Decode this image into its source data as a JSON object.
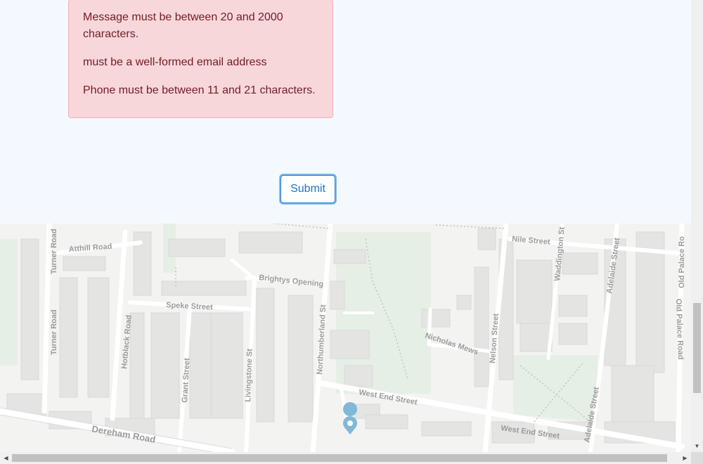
{
  "form": {
    "errors": [
      "Message must be between 20 and 2000 characters.",
      "must be a well-formed email address",
      "Phone must be between 11 and 21 characters."
    ],
    "submit_label": "Submit"
  },
  "map": {
    "streets": {
      "atthill": "Atthill Road",
      "turner_top": "Turner Road",
      "turner": "Turner Road",
      "brightys": "Brightys Opening",
      "speke": "Speke Street",
      "hotblack": "Hotblack Road",
      "grant": "Grant Street",
      "livingstone": "Livingstone St",
      "northumberland": "Northumberland St",
      "nicholas": "Nicholas Mews",
      "nelson": "Nelson Street",
      "nile": "Nile Street",
      "waddington": "Waddington St",
      "adelaide_top": "Adelaide Street",
      "adelaide_bottom": "Adelaide Street",
      "old_palace_1": "Old Palace Ro",
      "old_palace_2": "Old Palace Road",
      "west_end_1": "West End Street",
      "west_end_2": "West End Street",
      "dereham": "Dereham Road"
    },
    "colors": {
      "background": "#f3f3f1",
      "buildings": "#e4e4e2",
      "roads": "#ffffff",
      "green": "#e6efe6",
      "marker": "#7fb9d6"
    },
    "marker_icon": "location-pin-icon"
  },
  "scrollbars": {
    "up_arrow": "▲",
    "down_arrow": "▼",
    "left_arrow": "◀",
    "right_arrow": "▶"
  }
}
